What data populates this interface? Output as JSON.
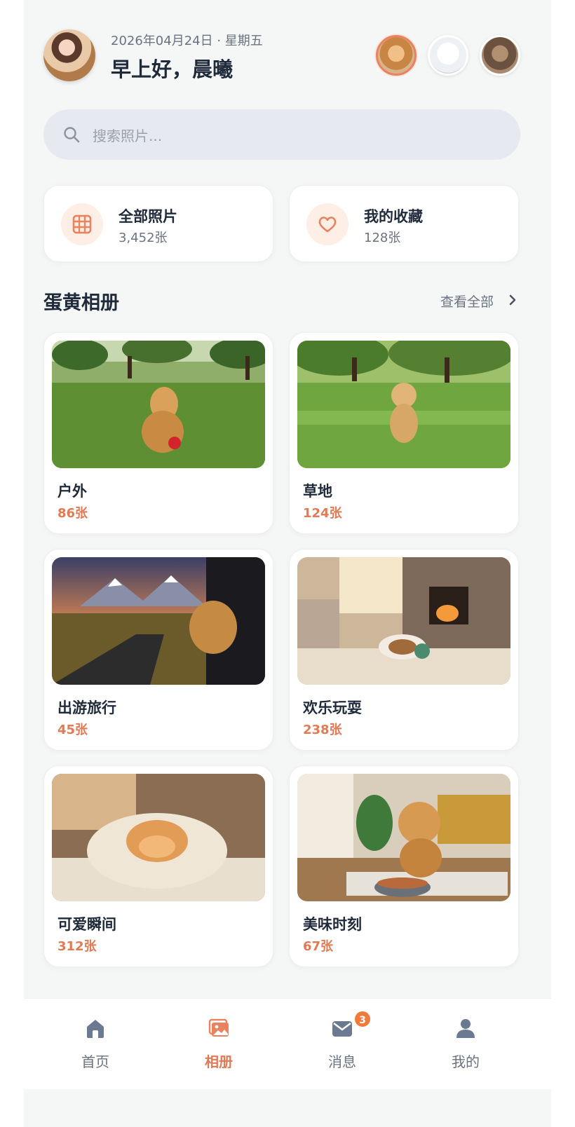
{
  "header": {
    "date": "2026年04月24日 · 星期五",
    "greeting": "早上好，晨曦"
  },
  "pets": [
    {
      "name": "golden-retriever",
      "selected": true
    },
    {
      "name": "samoyed",
      "selected": false
    },
    {
      "name": "tabby-cat",
      "selected": false
    }
  ],
  "search": {
    "placeholder": "搜索照片..."
  },
  "stats": {
    "all": {
      "title": "全部照片",
      "count": "3,452张",
      "icon": "grid-icon"
    },
    "favorites": {
      "title": "我的收藏",
      "count": "128张",
      "icon": "heart-icon"
    }
  },
  "section": {
    "title": "蛋黄相册",
    "see_all": "查看全部"
  },
  "albums": [
    {
      "name": "户外",
      "count": "86张"
    },
    {
      "name": "草地",
      "count": "124张"
    },
    {
      "name": "出游旅行",
      "count": "45张"
    },
    {
      "name": "欢乐玩耍",
      "count": "238张"
    },
    {
      "name": "可爱瞬间",
      "count": "312张"
    },
    {
      "name": "美味时刻",
      "count": "67张"
    }
  ],
  "nav": {
    "home": "首页",
    "albums": "相册",
    "messages": "消息",
    "messages_badge": "3",
    "me": "我的",
    "active": "albums"
  },
  "colors": {
    "accent": "#e07b55",
    "text_dark": "#1f2a3a",
    "text_muted": "#6b7280",
    "background": "#f5f7f6"
  }
}
